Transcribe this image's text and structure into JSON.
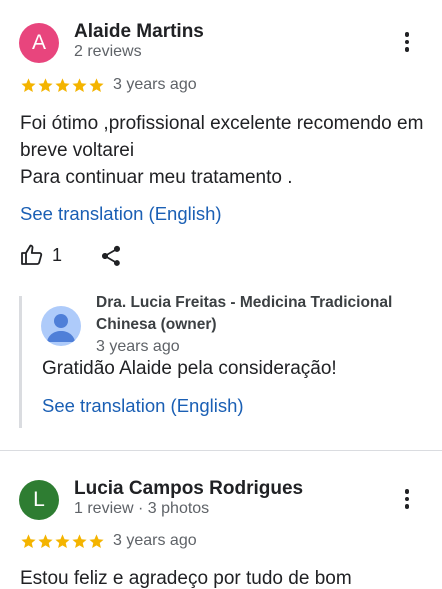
{
  "reviews": [
    {
      "avatar_letter": "A",
      "avatar_color": "#e8457d",
      "author": "Alaide Martins",
      "author_meta": "2 reviews",
      "rating": 5,
      "time_ago": "3 years ago",
      "text_lines": [
        "Foi ótimo ,profissional excelente recomendo em",
        "breve voltarei",
        "Para continuar meu tratamento ."
      ],
      "translation_link": "See translation (English)",
      "like_count": "1",
      "owner_reply": {
        "owner_name_line1": "Dra. Lucia Freitas - Medicina Tradicional",
        "owner_name_line2": "Chinesa (owner)",
        "time_ago": "3 years ago",
        "text": "Gratidão Alaide pela consideração!",
        "translation_link": "See translation (English)"
      }
    },
    {
      "avatar_letter": "L",
      "avatar_color": "#2e7d32",
      "author": "Lucia Campos Rodrigues",
      "author_meta": "1 review · 3 photos",
      "rating": 5,
      "time_ago": "3 years ago",
      "text_lines": [
        "Estou feliz e agradeço por tudo de bom"
      ]
    }
  ],
  "colors": {
    "star": "#f4b400",
    "link": "#1a5fb4",
    "owner_avatar_bg": "#aecbfa",
    "owner_avatar_fg": "#4f7fd8"
  },
  "icons": {
    "like": "thumb-up-icon",
    "share": "share-icon",
    "more": "more-vert-icon"
  }
}
